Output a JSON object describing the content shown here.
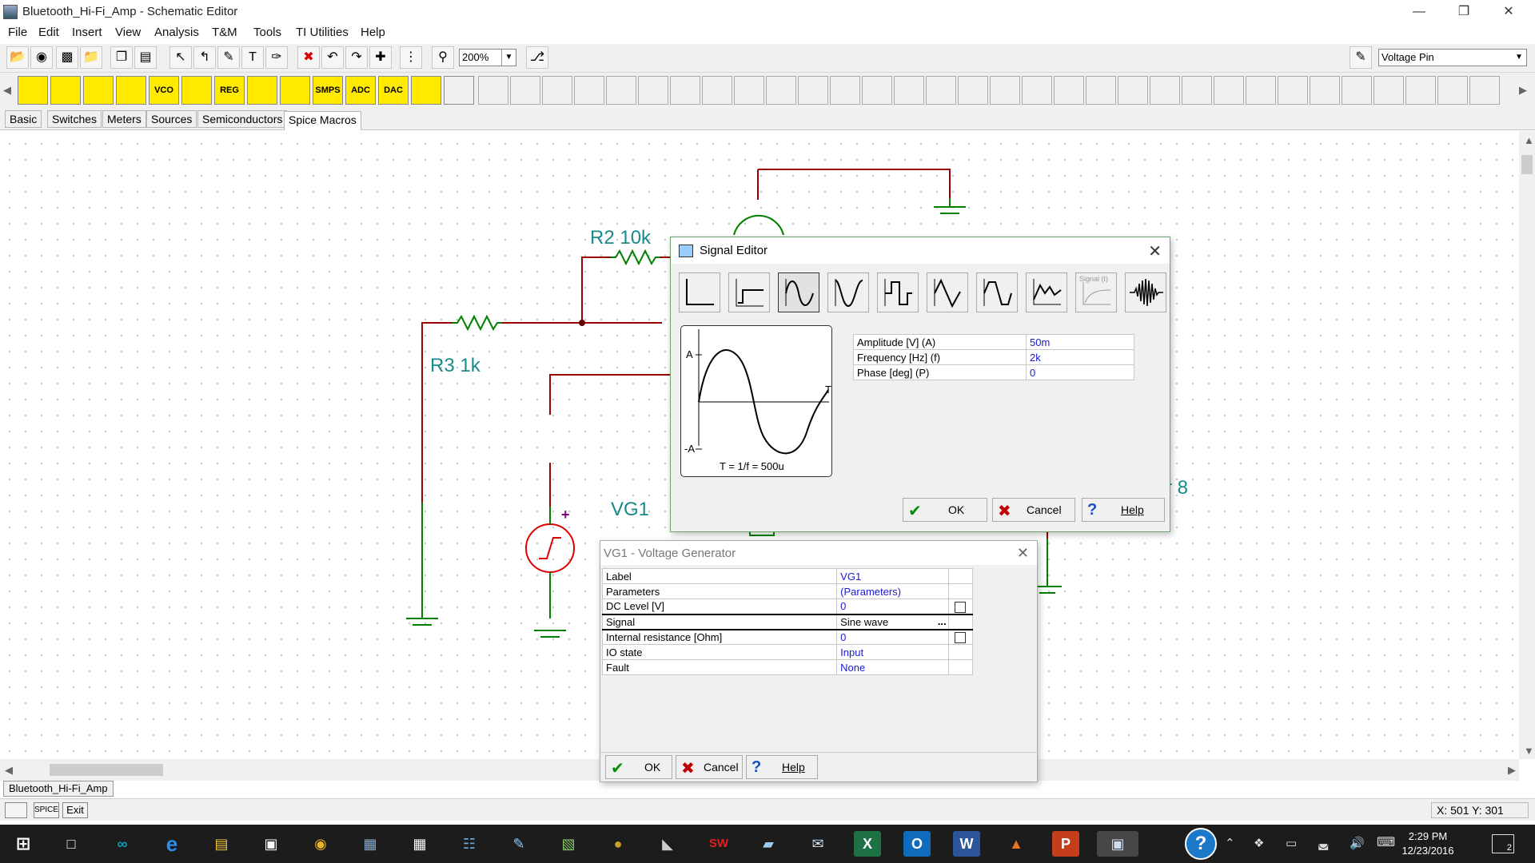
{
  "window": {
    "title": "Bluetooth_Hi-Fi_Amp - Schematic Editor",
    "controls": [
      "—",
      "❐",
      "✕"
    ]
  },
  "menu": [
    "File",
    "Edit",
    "Insert",
    "View",
    "Analysis",
    "T&M",
    "Tools",
    "TI Utilities",
    "Help"
  ],
  "toolbar": {
    "zoom": "200%",
    "pin_type": "Voltage Pin",
    "icons": [
      "open-icon",
      "globe-icon",
      "save-icon",
      "open-folder-icon",
      "copy-icon",
      "paste-icon",
      "pointer-icon",
      "wire-icon",
      "pen-icon",
      "text-icon",
      "pencil-icon",
      "delete-icon",
      "undo-icon",
      "redo-icon",
      "junction-icon",
      "grid-icon",
      "zoom-icon",
      "probe-icon",
      "pin-tool-icon"
    ]
  },
  "component_toolbar": {
    "labels": [
      "",
      "",
      "",
      "",
      "VCO",
      "",
      "REG",
      "",
      "",
      "SMPS",
      "ADC",
      "DAC",
      "",
      ""
    ]
  },
  "component_tabs": [
    "Basic",
    "Switches",
    "Meters",
    "Sources",
    "Semiconductors",
    "Spice Macros"
  ],
  "schematic": {
    "labels": {
      "r2": "R2 10k",
      "r3": "R3 1k",
      "vg1": "VG1",
      "speaker_partial": "r 8",
      "plus": "+"
    }
  },
  "signal_editor": {
    "title": "Signal Editor",
    "waveforms": [
      "unit-step",
      "step",
      "sine",
      "cosine",
      "square",
      "triangle",
      "trapezoid",
      "piecewise",
      "signal-t",
      "burst"
    ],
    "waveform_signal_label": "Signal (t)",
    "preview": {
      "a_pos": "A",
      "a_neg": "-A",
      "t_axis": "T",
      "period": "T = 1/f = 500u"
    },
    "params": [
      {
        "name": "Amplitude [V] (A)",
        "value": "50m"
      },
      {
        "name": "Frequency [Hz] (f)",
        "value": "2k"
      },
      {
        "name": "Phase [deg] (P)",
        "value": "0"
      }
    ],
    "ok": "OK",
    "cancel": "Cancel",
    "help": "Help"
  },
  "vg1_dialog": {
    "title": "VG1 - Voltage Generator",
    "rows": [
      {
        "name": "Label",
        "value": "VG1"
      },
      {
        "name": "Parameters",
        "value": "(Parameters)"
      },
      {
        "name": "DC Level [V]",
        "value": "0"
      },
      {
        "name": "Signal",
        "value": "Sine wave"
      },
      {
        "name": "Internal resistance [Ohm]",
        "value": "0"
      },
      {
        "name": "IO state",
        "value": "Input"
      },
      {
        "name": "Fault",
        "value": "None"
      }
    ],
    "ellipsis": "...",
    "ok": "OK",
    "cancel": "Cancel",
    "help": "Help"
  },
  "bottom": {
    "doc_tab": "Bluetooth_Hi-Fi_Amp",
    "status_buttons": [
      "",
      "SPICE",
      "Exit"
    ],
    "coords": "X: 501  Y: 301"
  },
  "taskbar": {
    "apps": [
      "start-icon",
      "task-view-icon",
      "arduino-icon",
      "edge-icon",
      "explorer-icon",
      "store-icon",
      "chrome-icon",
      "app-icon",
      "calculator-icon",
      "network-app-icon",
      "notepad-icon",
      "photo-icon",
      "sphere-app-icon",
      "tool-app-icon",
      "solidworks-icon",
      "files-app-icon",
      "mail-app-icon",
      "excel-icon",
      "outlook-icon",
      "word-icon",
      "matlab-icon",
      "powerpoint-icon",
      "tina-icon"
    ],
    "app_glyphs": [
      "⊞",
      "□",
      "∞",
      "e",
      "▤",
      "▣",
      "◉",
      "▦",
      "▦",
      "☷",
      "✎",
      "▧",
      "●",
      "◣",
      "SW",
      "▰",
      "✉",
      "X",
      "O",
      "W",
      "▲",
      "P",
      "▣"
    ],
    "help": "?",
    "time": "2:29 PM",
    "date": "12/23/2016",
    "notifications": "2"
  }
}
